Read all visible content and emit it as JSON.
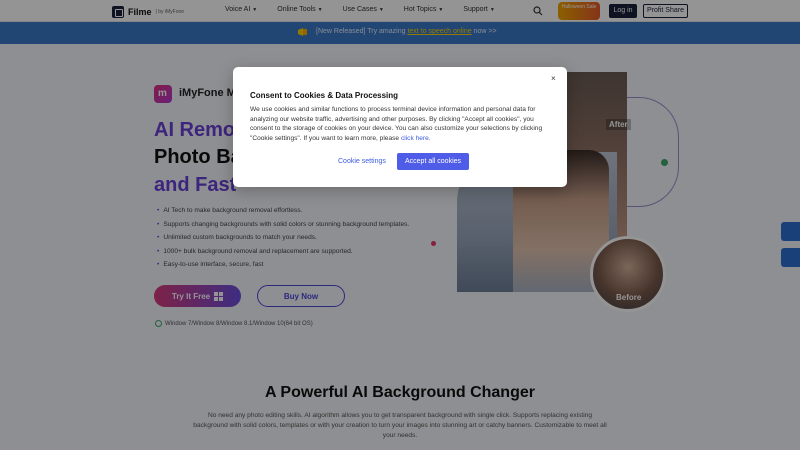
{
  "header": {
    "logo_text": "Filme",
    "logo_sub": "| by iMyFone",
    "nav": [
      "Voice AI",
      "Online Tools",
      "Use Cases",
      "Hot Topics",
      "Support"
    ],
    "promo_badge": "Halloween Sale",
    "login_label": "Log in",
    "profit_label": "Profit Share"
  },
  "banner": {
    "prefix": "[New Released] Try amazing",
    "link": "text to speech online",
    "suffix": "now >>"
  },
  "hero": {
    "product_name": "iMyFone M",
    "title_line1": "AI Remov",
    "title_line2": "Photo Ba",
    "title_line3": "and Fast",
    "features": [
      "AI Tech to make background removal effortless.",
      "Supports changing backgrounds with solid colors or stunning background templates.",
      "Unlimited custom backgrounds to match your needs.",
      "1000+ bulk background removal and replacement are supported.",
      "Easy-to-use interface, secure, fast"
    ],
    "try_label": "Try It Free",
    "buy_label": "Buy Now",
    "os_text": "Window 7/Window 8/Window 8.1/Window 10(64 bit OS)",
    "after_label": "After",
    "before_label": "Before"
  },
  "section": {
    "title": "A Powerful AI Background Changer",
    "desc": "No need any photo editing skills. AI algorithm allows you to get transparent background with single click. Supports replacing existing background with solid colors, templates or with your creation to turn your images into stunning art or catchy banners. Customizable to meet all your needs."
  },
  "modal": {
    "close": "×",
    "title": "Consent to Cookies & Data Processing",
    "body": "We use cookies and similar functions to process terminal device information and personal data for analyzing our website traffic, advertising and other purposes. By clicking \"Accept all cookies\", you consent to the storage of cookies on your device. You can also customize your selections by clicking \"Cookie settings\". If you want to learn more, please",
    "body_link": "click here.",
    "settings_label": "Cookie settings",
    "accept_label": "Accept all cookies"
  },
  "colors": {
    "accent": "#6a3fd6",
    "banner": "#3b79c9",
    "primary_button": "#4f5ce8"
  }
}
